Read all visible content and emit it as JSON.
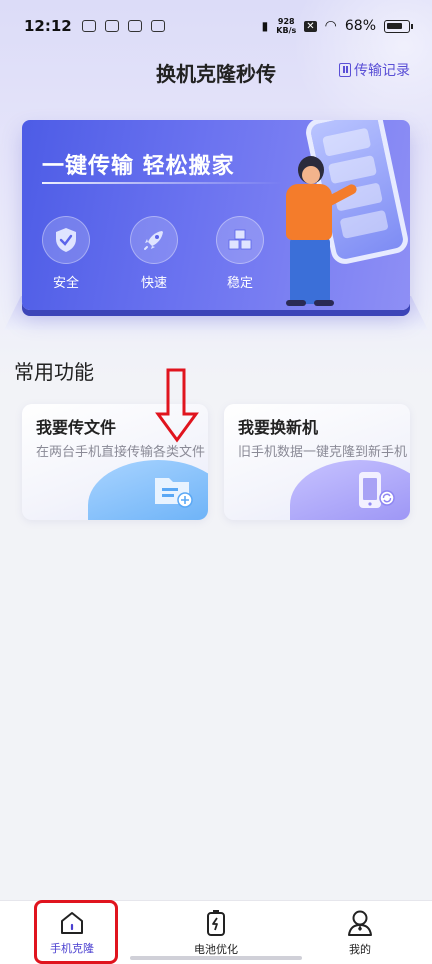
{
  "status_bar": {
    "time": "12:12",
    "net_speed_value": "928",
    "net_speed_unit": "KB/s",
    "battery": "68%"
  },
  "header": {
    "title": "换机克隆秒传",
    "history_label": "传输记录"
  },
  "banner": {
    "headline": "一键传输  轻松搬家",
    "features": [
      {
        "label": "安全",
        "icon": "shield-check-icon"
      },
      {
        "label": "快速",
        "icon": "rocket-icon"
      },
      {
        "label": "稳定",
        "icon": "cubes-icon"
      }
    ]
  },
  "section": {
    "title": "常用功能"
  },
  "cards": [
    {
      "title": "我要传文件",
      "desc": "在两台手机直接传输各类文件",
      "icon": "folder-icon"
    },
    {
      "title": "我要换新机",
      "desc": "旧手机数据一键克隆到新手机",
      "icon": "phone-icon"
    }
  ],
  "bottom_nav": [
    {
      "label": "手机克隆",
      "icon": "home-icon",
      "active": true
    },
    {
      "label": "电池优化",
      "icon": "battery-charge-icon",
      "active": false
    },
    {
      "label": "我的",
      "icon": "person-icon",
      "active": false
    }
  ],
  "colors": {
    "accent": "#5a4fd6",
    "banner": "#5b64ea",
    "annotation": "#e0141e"
  }
}
